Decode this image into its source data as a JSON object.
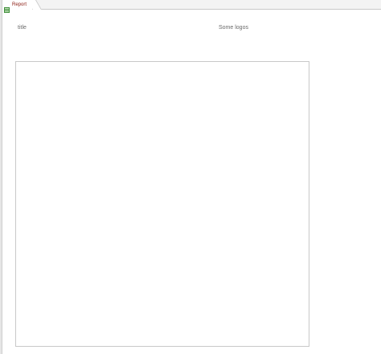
{
  "tab": {
    "label": "Report",
    "icon": "report-icon"
  },
  "header": {
    "title": "title",
    "logos": "Some logos"
  },
  "colors": {
    "tab_label": "#8b1c12",
    "icon_green": "#3f8f3a",
    "text_gray": "#6a6a6a",
    "border_gray": "#c8c8c8"
  }
}
